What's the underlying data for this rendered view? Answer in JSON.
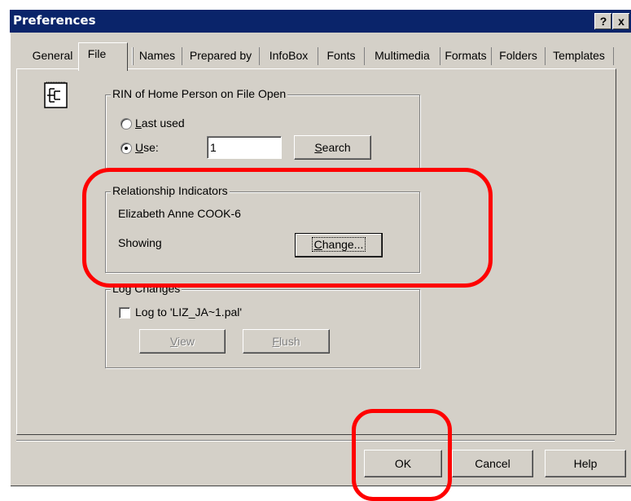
{
  "window": {
    "title": "Preferences",
    "help_btn": "?",
    "close_btn": "x"
  },
  "tabs": [
    "General",
    "File",
    "Names",
    "Prepared by",
    "InfoBox",
    "Fonts",
    "Multimedia",
    "Formats",
    "Folders",
    "Templates"
  ],
  "active_tab": "File",
  "rin_group": {
    "legend": "RIN of Home Person on File Open",
    "last_used": {
      "mnemonic": "L",
      "rest": "ast used",
      "checked": false
    },
    "use": {
      "mnemonic": "U",
      "rest": "se:",
      "checked": true
    },
    "value": "1",
    "search": {
      "mnemonic": "S",
      "rest": "earch"
    }
  },
  "relationship_group": {
    "legend": "Relationship Indicators",
    "person": "Elizabeth Anne COOK-6",
    "status": "Showing",
    "change": {
      "mnemonic": "C",
      "rest": "hange..."
    }
  },
  "log_group": {
    "legend": "Log Changes",
    "log_label": "Log to 'LIZ_JA~1.pal'",
    "log_checked": false,
    "view": {
      "mnemonic": "V",
      "rest": "iew"
    },
    "flush": {
      "mnemonic": "F",
      "rest": "lush"
    }
  },
  "footer": {
    "ok": "OK",
    "cancel": "Cancel",
    "help": "Help"
  },
  "colors": {
    "titlebar": "#0a246a",
    "face": "#d4d0c8",
    "highlight": "#ff0000"
  }
}
